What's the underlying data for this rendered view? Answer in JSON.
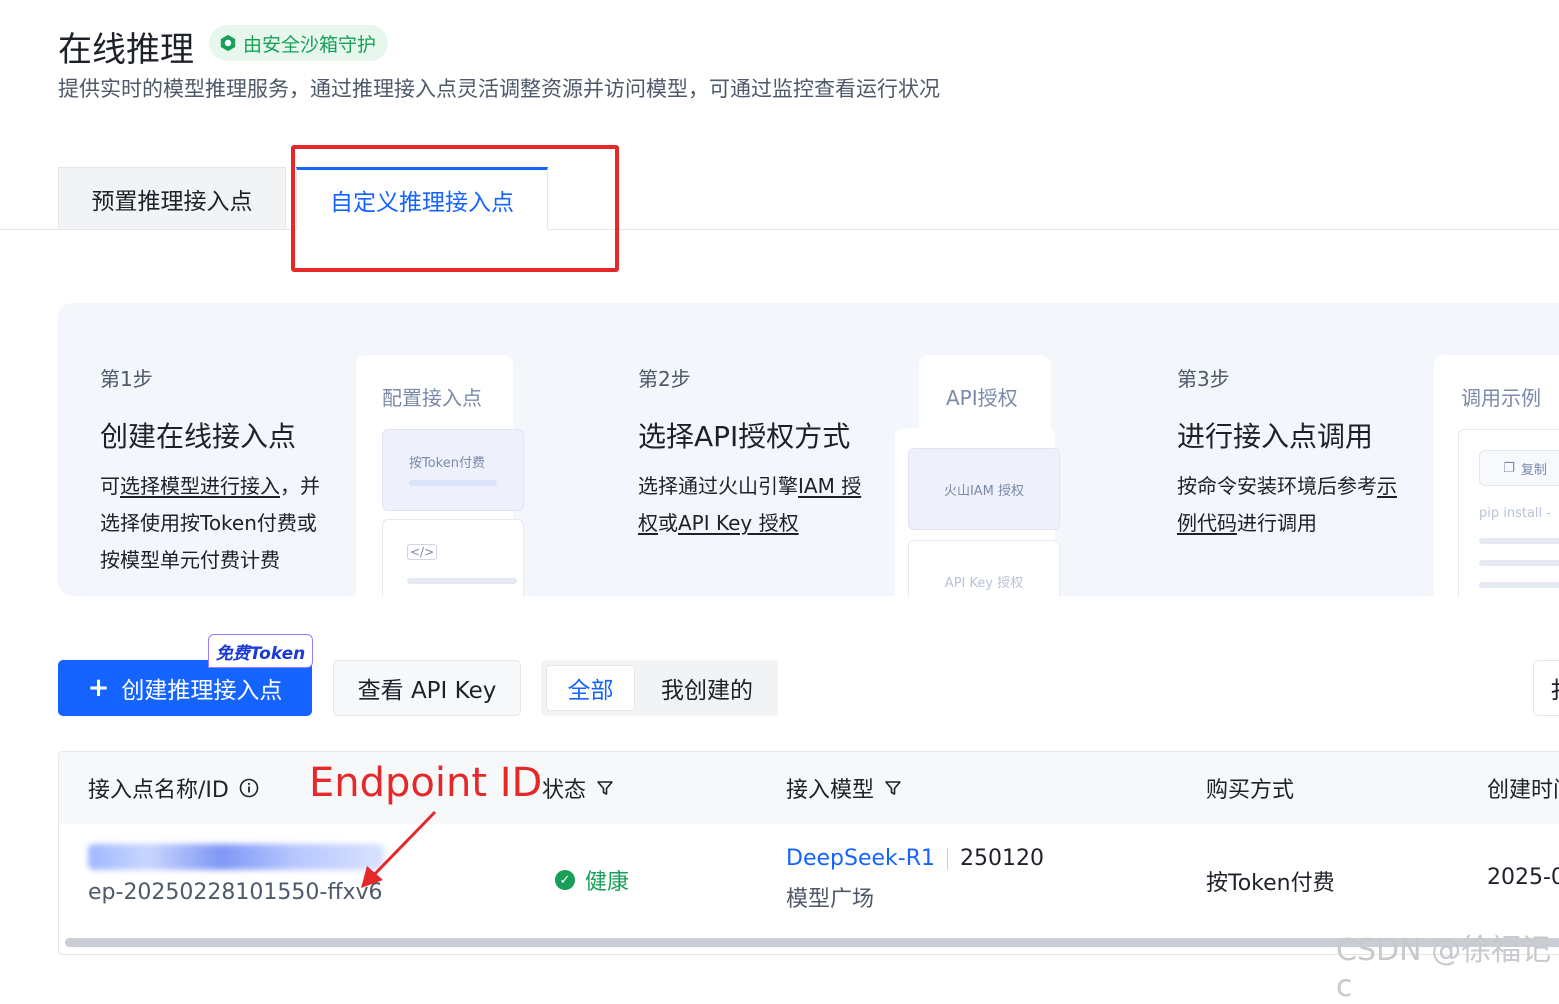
{
  "header": {
    "title": "在线推理",
    "badge": "由安全沙箱守护",
    "subtitle": "提供实时的模型推理服务，通过推理接入点灵活调整资源并访问模型，可通过监控查看运行状况"
  },
  "tabs": [
    {
      "label": "预置推理接入点",
      "active": false
    },
    {
      "label": "自定义推理接入点",
      "active": true
    }
  ],
  "steps": [
    {
      "label": "第1步",
      "title": "创建在线接入点",
      "desc_pre": "可",
      "desc_link": "选择模型进行接入",
      "desc_post": "，并",
      "desc_line2": "选择使用按Token付费或",
      "desc_line3": "按模型单元付费计费",
      "card_head": "配置接入点",
      "card_item": "按Token付费"
    },
    {
      "label": "第2步",
      "title": "选择API授权方式",
      "desc_pre": "选择通过火山引擎",
      "desc_link1": "IAM 授",
      "desc_link1b": "权",
      "desc_mid": "或",
      "desc_link2": "API Key 授权",
      "card_head": "API授权",
      "card_item1": "火山IAM 授权",
      "card_item2": "API Key 授权"
    },
    {
      "label": "第3步",
      "title": "进行接入点调用",
      "desc_pre": "按命令安装环境后参考",
      "desc_link": "示",
      "desc_link2": "例代码",
      "desc_post": "进行调用",
      "card_head": "调用示例",
      "card_copy": "复制",
      "card_code": "pip install -"
    }
  ],
  "toolbar": {
    "create_label": "创建推理接入点",
    "free_tag": "免费Token",
    "api_key_label": "查看 API Key",
    "filter_all": "全部",
    "filter_mine": "我创建的",
    "right_btn": "扌"
  },
  "table": {
    "columns": [
      "接入点名称/ID",
      "状态",
      "接入模型",
      "购买方式",
      "创建时间"
    ],
    "rows": [
      {
        "endpoint_id": "ep-20250228101550-ffxv6",
        "status": "健康",
        "model_name": "DeepSeek-R1",
        "model_version": "250120",
        "model_source": "模型广场",
        "purchase": "按Token付费",
        "created": "2025-0"
      }
    ]
  },
  "annotation": "Endpoint ID",
  "watermark": "CSDN @徐福记c",
  "colors": {
    "accent": "#1664ff",
    "success": "#18a058",
    "annotation": "#e5282a"
  }
}
